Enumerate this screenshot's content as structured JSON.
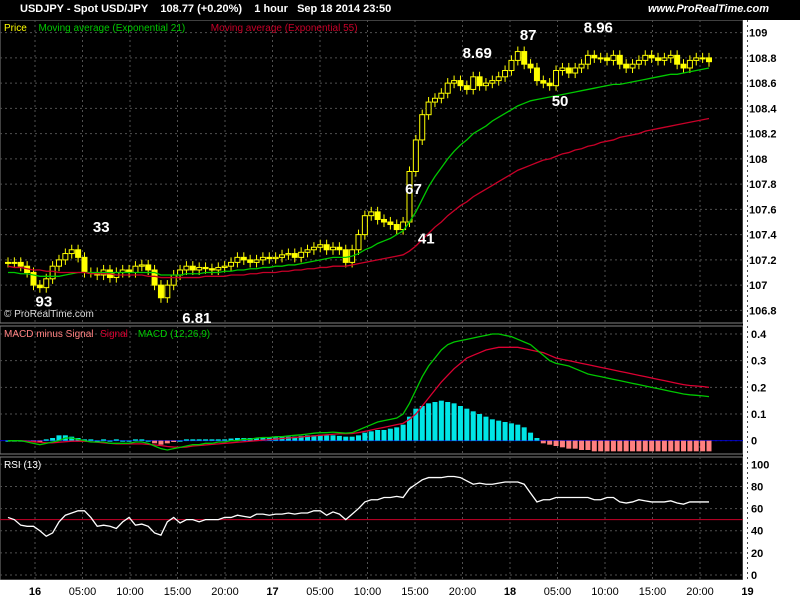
{
  "header": {
    "title": "USDJPY - Spot USD/JPY",
    "price": "108.77 (+0.20%)",
    "timeframe": "1 hour",
    "datetime": "Sep 18 2014 23:50",
    "watermark": "www.ProRealTime.com",
    "copyright": "© ProRealTime.com"
  },
  "colors": {
    "background": "#000000",
    "bull_candle": "#ffff00",
    "bear_candle": "#ffff00",
    "ema21": "#00c800",
    "ema55": "#c80028",
    "macd_line": "#00c800",
    "signal_line": "#dc0032",
    "hist_pos": "#00e6e6",
    "hist_neg": "#ff8080",
    "rsi": "#ffffff",
    "rsi_level": "#c80028",
    "grid": "#505050"
  },
  "chart_data": [
    {
      "type": "candlestick",
      "panel": "price",
      "legend": [
        {
          "name": "Price",
          "color": "#ffff00"
        },
        {
          "name": "Moving average (Exponential 21)",
          "color": "#00c800"
        },
        {
          "name": "Moving average (Exponential 55)",
          "color": "#c80028"
        }
      ],
      "ylim": [
        106.7,
        109.1
      ],
      "y_ticks": [
        "106.8",
        "107",
        "107.2",
        "107.4",
        "107.6",
        "107.8",
        "108",
        "108.2",
        "108.4",
        "108.6",
        "108.8",
        "109"
      ],
      "x_ticks": [
        "16",
        "05:00",
        "10:00",
        "15:00",
        "20:00",
        "17",
        "05:00",
        "10:00",
        "15:00",
        "20:00",
        "18",
        "05:00",
        "10:00",
        "15:00",
        "20:00",
        "19"
      ],
      "annotations": [
        "93",
        "33",
        "6.81",
        "67",
        "41",
        "8.69",
        "87",
        "50",
        "8.96"
      ],
      "closes": [
        107.18,
        107.18,
        107.15,
        107.1,
        107.0,
        106.98,
        107.05,
        107.15,
        107.2,
        107.25,
        107.28,
        107.22,
        107.1,
        107.1,
        107.08,
        107.12,
        107.06,
        107.1,
        107.12,
        107.1,
        107.15,
        107.16,
        107.12,
        107.0,
        106.9,
        107.0,
        107.08,
        107.12,
        107.15,
        107.12,
        107.14,
        107.13,
        107.12,
        107.14,
        107.15,
        107.18,
        107.22,
        107.2,
        107.18,
        107.2,
        107.22,
        107.21,
        107.22,
        107.24,
        107.25,
        107.22,
        107.26,
        107.28,
        107.3,
        107.32,
        107.28,
        107.3,
        107.28,
        107.18,
        107.28,
        107.4,
        107.55,
        107.58,
        107.52,
        107.5,
        107.48,
        107.44,
        107.5,
        107.9,
        108.15,
        108.35,
        108.45,
        108.48,
        108.52,
        108.6,
        108.62,
        108.58,
        108.55,
        108.65,
        108.58,
        108.6,
        108.62,
        108.65,
        108.7,
        108.78,
        108.85,
        108.75,
        108.72,
        108.62,
        108.6,
        108.58,
        108.7,
        108.72,
        108.68,
        108.72,
        108.75,
        108.82,
        108.8,
        108.8,
        108.78,
        108.82,
        108.75,
        108.72,
        108.75,
        108.78,
        108.82,
        108.8,
        108.78,
        108.8,
        108.82,
        108.75,
        108.72,
        108.78,
        108.8,
        108.8,
        108.77
      ],
      "ema21": [
        107.1,
        107.1,
        107.09,
        107.09,
        107.08,
        107.07,
        107.07,
        107.07,
        107.07,
        107.08,
        107.09,
        107.1,
        107.1,
        107.1,
        107.1,
        107.1,
        107.1,
        107.1,
        107.1,
        107.1,
        107.1,
        107.1,
        107.1,
        107.1,
        107.08,
        107.08,
        107.08,
        107.08,
        107.09,
        107.09,
        107.09,
        107.1,
        107.1,
        107.1,
        107.11,
        107.11,
        107.12,
        107.12,
        107.13,
        107.13,
        107.14,
        107.14,
        107.15,
        107.15,
        107.16,
        107.16,
        107.17,
        107.18,
        107.19,
        107.2,
        107.21,
        107.22,
        107.22,
        107.22,
        107.23,
        107.25,
        107.28,
        107.3,
        107.33,
        107.35,
        107.37,
        107.4,
        107.43,
        107.5,
        107.58,
        107.68,
        107.78,
        107.86,
        107.93,
        108.0,
        108.06,
        108.11,
        108.15,
        108.2,
        108.23,
        108.26,
        108.3,
        108.33,
        108.36,
        108.39,
        108.42,
        108.44,
        108.46,
        108.47,
        108.48,
        108.49,
        108.5,
        108.51,
        108.52,
        108.53,
        108.54,
        108.55,
        108.56,
        108.57,
        108.58,
        108.59,
        108.59,
        108.6,
        108.61,
        108.62,
        108.63,
        108.64,
        108.65,
        108.66,
        108.67,
        108.67,
        108.68,
        108.69,
        108.7,
        108.71,
        108.72
      ],
      "ema55": [
        107.15,
        107.14,
        107.14,
        107.13,
        107.12,
        107.12,
        107.11,
        107.11,
        107.1,
        107.1,
        107.1,
        107.1,
        107.1,
        107.09,
        107.09,
        107.09,
        107.09,
        107.08,
        107.08,
        107.08,
        107.08,
        107.08,
        107.07,
        107.07,
        107.06,
        107.06,
        107.06,
        107.06,
        107.06,
        107.06,
        107.06,
        107.07,
        107.07,
        107.07,
        107.07,
        107.08,
        107.08,
        107.08,
        107.09,
        107.09,
        107.1,
        107.1,
        107.1,
        107.11,
        107.11,
        107.12,
        107.12,
        107.13,
        107.13,
        107.14,
        107.14,
        107.15,
        107.15,
        107.15,
        107.16,
        107.17,
        107.18,
        107.19,
        107.2,
        107.21,
        107.22,
        107.23,
        107.24,
        107.27,
        107.31,
        107.36,
        107.41,
        107.46,
        107.5,
        107.55,
        107.59,
        107.63,
        107.66,
        107.7,
        107.73,
        107.76,
        107.79,
        107.82,
        107.85,
        107.88,
        107.91,
        107.93,
        107.95,
        107.97,
        107.99,
        108.0,
        108.02,
        108.04,
        108.05,
        108.07,
        108.08,
        108.1,
        108.11,
        108.13,
        108.14,
        108.15,
        108.17,
        108.18,
        108.19,
        108.2,
        108.22,
        108.23,
        108.24,
        108.25,
        108.26,
        108.27,
        108.28,
        108.29,
        108.3,
        108.31,
        108.32
      ]
    },
    {
      "type": "bar",
      "panel": "macd",
      "legend": [
        {
          "name": "MACD minus Signal",
          "color": "#ff8080"
        },
        {
          "name": "Signal",
          "color": "#dc0032"
        },
        {
          "name": "MACD (12,26,9)",
          "color": "#00c800"
        }
      ],
      "ylim": [
        -0.05,
        0.43
      ],
      "y_ticks": [
        "0",
        "0.1",
        "0.2",
        "0.3",
        "0.4"
      ],
      "histogram": [
        0.0,
        0.0,
        0.0,
        0.0,
        -0.005,
        -0.005,
        0.005,
        0.01,
        0.02,
        0.02,
        0.015,
        0.01,
        0.005,
        0.005,
        0.0,
        0.005,
        0.0,
        0.005,
        0.0,
        0.0,
        0.005,
        0.005,
        0.0,
        -0.01,
        -0.015,
        -0.01,
        -0.005,
        0.0,
        0.005,
        0.005,
        0.005,
        0.005,
        0.005,
        0.005,
        0.005,
        0.008,
        0.01,
        0.01,
        0.01,
        0.01,
        0.012,
        0.012,
        0.012,
        0.015,
        0.015,
        0.015,
        0.018,
        0.02,
        0.02,
        0.022,
        0.02,
        0.02,
        0.018,
        0.015,
        0.015,
        0.02,
        0.03,
        0.035,
        0.04,
        0.04,
        0.045,
        0.05,
        0.06,
        0.09,
        0.12,
        0.13,
        0.14,
        0.145,
        0.15,
        0.145,
        0.14,
        0.13,
        0.12,
        0.11,
        0.1,
        0.09,
        0.08,
        0.075,
        0.07,
        0.065,
        0.06,
        0.05,
        0.03,
        0.01,
        -0.01,
        -0.015,
        -0.02,
        -0.025,
        -0.03,
        -0.03,
        -0.035,
        -0.035,
        -0.04,
        -0.04,
        -0.04,
        -0.04,
        -0.04,
        -0.04,
        -0.04,
        -0.04,
        -0.04,
        -0.04,
        -0.04,
        -0.04,
        -0.04,
        -0.04,
        -0.04,
        -0.04,
        -0.04,
        -0.04,
        -0.04
      ],
      "macd": [
        0.0,
        0.0,
        0.0,
        -0.005,
        -0.01,
        -0.015,
        -0.01,
        -0.005,
        0.0,
        0.01,
        0.01,
        0.005,
        0.0,
        -0.005,
        -0.005,
        -0.005,
        -0.01,
        -0.01,
        -0.01,
        -0.01,
        -0.005,
        -0.005,
        -0.01,
        -0.02,
        -0.03,
        -0.035,
        -0.03,
        -0.025,
        -0.02,
        -0.015,
        -0.015,
        -0.01,
        -0.01,
        -0.005,
        -0.005,
        0.0,
        0.0,
        0.005,
        0.005,
        0.01,
        0.012,
        0.012,
        0.015,
        0.015,
        0.018,
        0.02,
        0.022,
        0.025,
        0.028,
        0.03,
        0.03,
        0.032,
        0.03,
        0.028,
        0.03,
        0.04,
        0.05,
        0.06,
        0.07,
        0.075,
        0.08,
        0.085,
        0.1,
        0.14,
        0.19,
        0.24,
        0.28,
        0.31,
        0.34,
        0.36,
        0.37,
        0.375,
        0.38,
        0.385,
        0.39,
        0.395,
        0.4,
        0.4,
        0.395,
        0.39,
        0.38,
        0.37,
        0.36,
        0.34,
        0.32,
        0.3,
        0.29,
        0.285,
        0.28,
        0.27,
        0.26,
        0.25,
        0.245,
        0.24,
        0.235,
        0.23,
        0.225,
        0.22,
        0.215,
        0.21,
        0.205,
        0.2,
        0.195,
        0.19,
        0.185,
        0.18,
        0.175,
        0.172,
        0.17,
        0.168,
        0.165
      ],
      "signal": [
        0.0,
        0.0,
        0.0,
        -0.002,
        -0.004,
        -0.006,
        -0.008,
        -0.008,
        -0.006,
        -0.004,
        -0.002,
        -0.002,
        -0.002,
        -0.004,
        -0.006,
        -0.008,
        -0.01,
        -0.012,
        -0.012,
        -0.012,
        -0.012,
        -0.012,
        -0.014,
        -0.016,
        -0.018,
        -0.022,
        -0.024,
        -0.025,
        -0.024,
        -0.02,
        -0.018,
        -0.016,
        -0.014,
        -0.012,
        -0.01,
        -0.008,
        -0.006,
        -0.004,
        -0.002,
        0.0,
        0.002,
        0.004,
        0.006,
        0.008,
        0.01,
        0.012,
        0.014,
        0.016,
        0.018,
        0.02,
        0.022,
        0.024,
        0.026,
        0.026,
        0.027,
        0.03,
        0.035,
        0.04,
        0.045,
        0.05,
        0.055,
        0.06,
        0.065,
        0.08,
        0.1,
        0.13,
        0.16,
        0.19,
        0.22,
        0.245,
        0.27,
        0.29,
        0.31,
        0.32,
        0.33,
        0.34,
        0.345,
        0.35,
        0.35,
        0.35,
        0.35,
        0.345,
        0.34,
        0.335,
        0.33,
        0.32,
        0.31,
        0.305,
        0.3,
        0.295,
        0.29,
        0.285,
        0.28,
        0.275,
        0.27,
        0.265,
        0.26,
        0.255,
        0.25,
        0.245,
        0.24,
        0.235,
        0.23,
        0.225,
        0.22,
        0.215,
        0.21,
        0.207,
        0.205,
        0.203,
        0.2
      ]
    },
    {
      "type": "line",
      "panel": "rsi",
      "legend": [
        {
          "name": "RSI (13)",
          "color": "#ffffff"
        }
      ],
      "ylim": [
        0,
        100
      ],
      "y_ticks": [
        "0",
        "20",
        "40",
        "60",
        "80",
        "100"
      ],
      "level": 50,
      "values": [
        52,
        50,
        45,
        44,
        44,
        40,
        35,
        38,
        48,
        54,
        56,
        58,
        58,
        52,
        44,
        45,
        44,
        42,
        48,
        52,
        45,
        46,
        44,
        38,
        36,
        48,
        52,
        47,
        50,
        50,
        48,
        50,
        50,
        50,
        52,
        52,
        54,
        53,
        52,
        55,
        55,
        54,
        55,
        55,
        56,
        55,
        56,
        56,
        58,
        58,
        54,
        57,
        55,
        50,
        55,
        60,
        66,
        68,
        68,
        70,
        70,
        71,
        70,
        78,
        82,
        86,
        88,
        88,
        88,
        89,
        89,
        88,
        85,
        82,
        83,
        82,
        82,
        83,
        84,
        84,
        84,
        82,
        74,
        66,
        68,
        68,
        70,
        70,
        70,
        70,
        70,
        70,
        68,
        68,
        70,
        70,
        66,
        65,
        66,
        68,
        67,
        66,
        66,
        66,
        67,
        65,
        64,
        66,
        66,
        66,
        66
      ]
    }
  ]
}
